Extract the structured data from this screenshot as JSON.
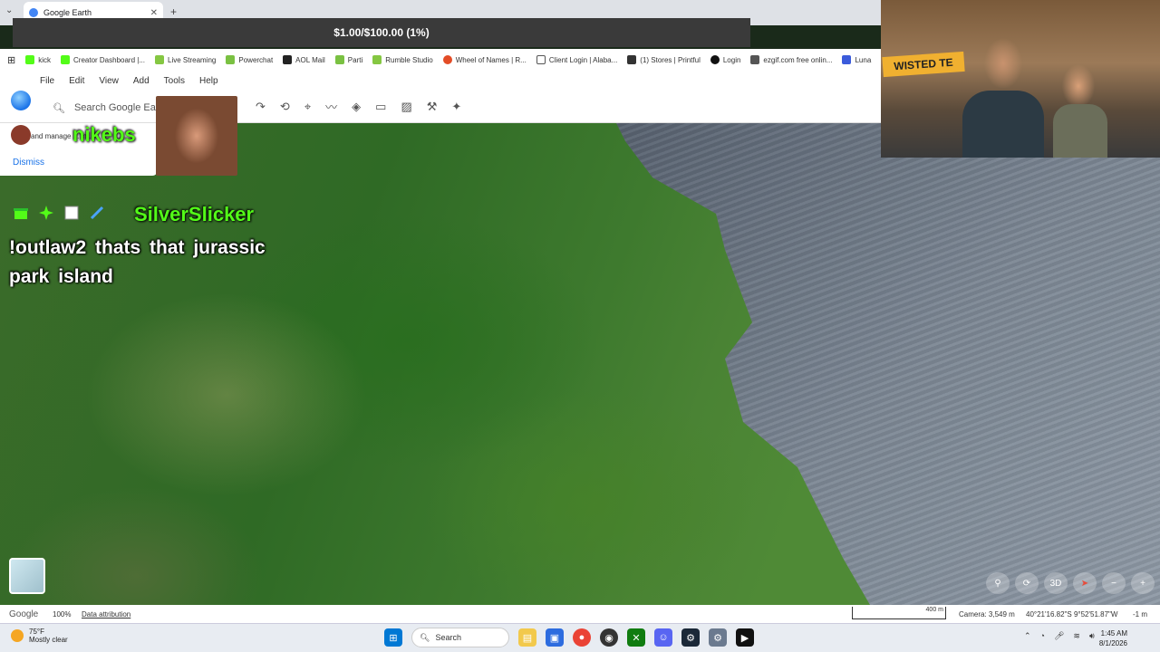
{
  "browser": {
    "tab_title": "Google Earth",
    "new_tab": "+",
    "tab_close": "✕"
  },
  "donation": {
    "text": "$1.00/$100.00 (1%)"
  },
  "bookmarks": [
    {
      "label": "kick",
      "color": "#53fc18"
    },
    {
      "label": "Creator Dashboard |...",
      "color": "#53fc18"
    },
    {
      "label": "Live Streaming",
      "color": "#85c742"
    },
    {
      "label": "Powerchat",
      "color": "#7ac142"
    },
    {
      "label": "AOL Mail",
      "color": "#222222"
    },
    {
      "label": "Parti",
      "color": "#7ac142"
    },
    {
      "label": "Rumble Studio",
      "color": "#85c742"
    },
    {
      "label": "Wheel of Names | R...",
      "color": "#e34c26"
    },
    {
      "label": "Client Login | Alaba...",
      "color": "#555555"
    },
    {
      "label": "(1) Stores | Printful",
      "color": "#333333"
    },
    {
      "label": "Login",
      "color": "#111111"
    },
    {
      "label": "ezgif.com free onlin...",
      "color": "#555555"
    },
    {
      "label": "Luna",
      "color": "#3b5bdb"
    }
  ],
  "menu": [
    "File",
    "Edit",
    "View",
    "Add",
    "Tools",
    "Help"
  ],
  "search": {
    "placeholder": "Search Google Earth"
  },
  "panel": {
    "snippet": "and manage ... in ...",
    "dismiss": "Dismiss"
  },
  "chat": {
    "user1": "nikebs",
    "user2": "SilverSlicker",
    "message": "!outlaw2 thats that jurassic park island"
  },
  "webcam": {
    "sign_text": "WISTED TE"
  },
  "map_controls": [
    "3D"
  ],
  "status": {
    "google": "Google",
    "zoom": "100%",
    "attribution": "Data attribution",
    "scale": "400 m",
    "camera": "Camera: 3,549 m",
    "coords": "40°21'16.82\"S 9°52'51.87\"W",
    "altitude": "-1 m"
  },
  "taskbar": {
    "weather_temp": "75°F",
    "weather_desc": "Mostly clear",
    "search_label": "Search",
    "time": "1:45 AM",
    "date": "8/1/2026"
  },
  "colors": {
    "kick_green": "#53fc18",
    "accent_blue": "#1a73e8"
  }
}
